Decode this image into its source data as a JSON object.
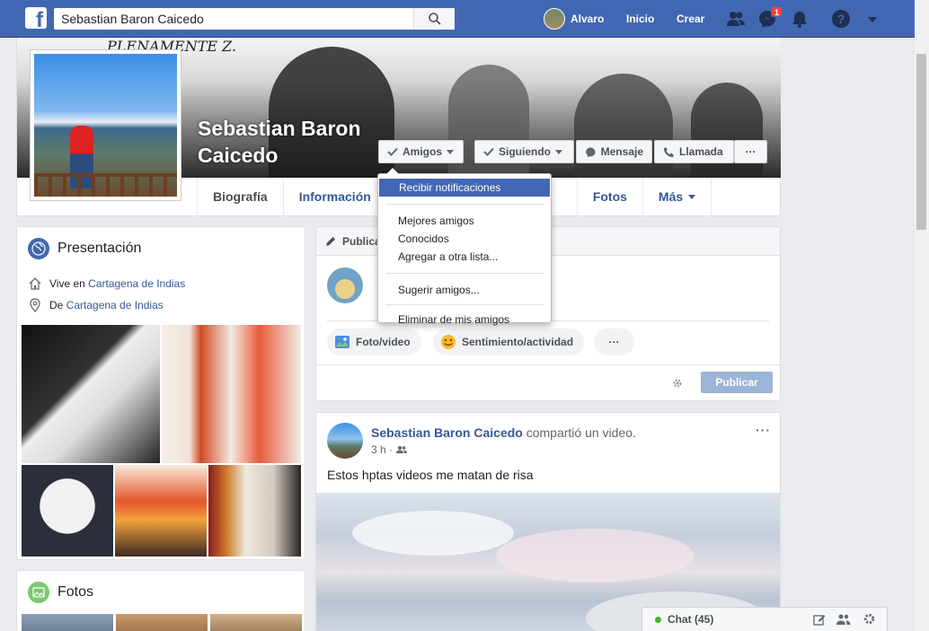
{
  "topbar": {
    "search_value": "Sebastian Baron Caicedo",
    "user_name": "Alvaro",
    "home_label": "Inicio",
    "create_label": "Crear",
    "messages_badge": "1"
  },
  "profile": {
    "name": "Sebastian Baron Caicedo",
    "cover_text": "PLENAMENTE Z.",
    "buttons": {
      "friends": "Amigos",
      "following": "Siguiendo",
      "message": "Mensaje",
      "call": "Llamada",
      "more": "···"
    },
    "tabs": [
      "Biografía",
      "Información",
      "Fotos",
      "Más"
    ]
  },
  "friends_menu": {
    "items": [
      "Recibir notificaciones",
      "Mejores amigos",
      "Conocidos",
      "Agregar a otra lista...",
      "Sugerir amigos...",
      "Eliminar de mis amigos"
    ]
  },
  "intro": {
    "title": "Presentación",
    "lives_prefix": "Vive en",
    "lives_city": "Cartagena de Indias",
    "from_prefix": "De",
    "from_city": "Cartagena de Indias"
  },
  "photos_card": {
    "title": "Fotos"
  },
  "composer": {
    "tab_label": "Publica",
    "photo_video": "Foto/video",
    "feeling": "Sentimiento/actividad",
    "more": "···",
    "publish": "Publicar"
  },
  "post": {
    "author": "Sebastian Baron Caicedo",
    "action": "compartió un video.",
    "time": "3 h ·",
    "text": "Estos hptas videos me matan de risa",
    "menu": "···"
  },
  "chat": {
    "label": "Chat (45)"
  }
}
